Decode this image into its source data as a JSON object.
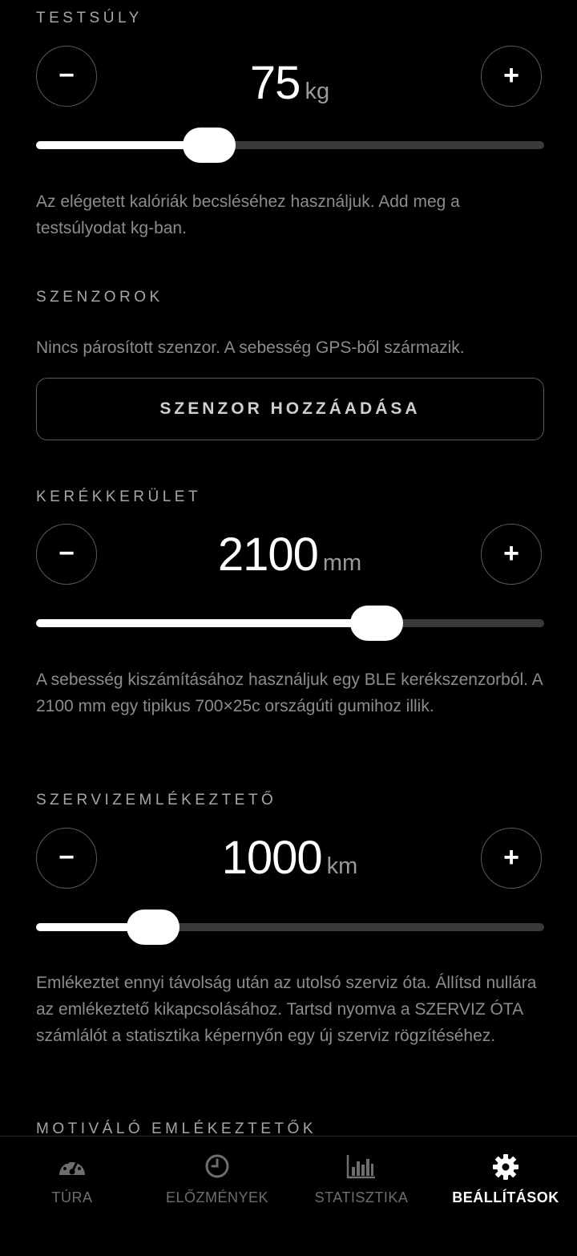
{
  "weight": {
    "label": "TESTSÚLY",
    "value": "75",
    "unit": "kg",
    "slider_fraction": 0.34,
    "help": "Az elégetett kalóriák becsléséhez használjuk. Add meg a testsúlyodat kg-ban."
  },
  "sensors": {
    "label": "SZENZOROK",
    "status": "Nincs párosított szenzor. A sebesség GPS-ből származik.",
    "add_button": "SZENZOR HOZZÁADÁSA"
  },
  "wheel": {
    "label": "KERÉKKERÜLET",
    "value": "2100",
    "unit": "mm",
    "slider_fraction": 0.67,
    "help": "A sebesség kiszámításához használjuk egy BLE kerékszenzorból. A 2100 mm egy tipikus 700×25c országúti gumihoz illik."
  },
  "service": {
    "label": "SZERVIZEMLÉKEZTETŐ",
    "value": "1000",
    "unit": "km",
    "slider_fraction": 0.23,
    "help": "Emlékeztet ennyi távolság után az utolsó szerviz óta. Állítsd nullára az emlékeztető kikapcsolásához. Tartsd nyomva a SZERVIZ ÓTA számlálót a statisztika képernyőn egy új szerviz rögzítéséhez."
  },
  "motivation": {
    "label": "MOTIVÁLÓ EMLÉKEZTETŐK"
  },
  "buttons": {
    "minus": "−",
    "plus": "+"
  },
  "tabs": [
    {
      "label": "TÚRA",
      "icon": "speedometer-icon",
      "active": false
    },
    {
      "label": "ELŐZMÉNYEK",
      "icon": "clock-icon",
      "active": false
    },
    {
      "label": "STATISZTIKA",
      "icon": "bar-chart-icon",
      "active": false
    },
    {
      "label": "BEÁLLÍTÁSOK",
      "icon": "gear-icon",
      "active": true
    }
  ],
  "colors": {
    "background": "#000000",
    "accent": "#ffffff",
    "muted_text": "#8c8c8c",
    "track": "#3a3a3a"
  }
}
